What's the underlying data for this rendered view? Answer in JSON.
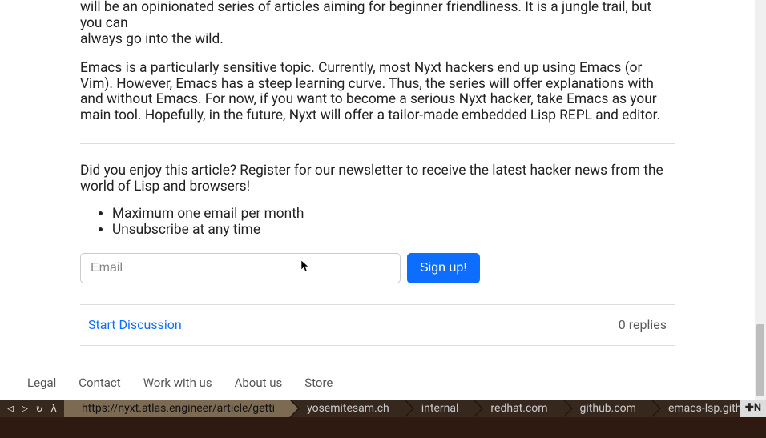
{
  "article": {
    "partial_top_line": "will be an opinionated series of articles aiming for beginner friendliness. It is a jungle trail, but you can",
    "partial_top_line2": "always go into the wild.",
    "paragraph2": "Emacs is a particularly sensitive topic. Currently, most Nyxt hackers end up using Emacs (or Vim). However, Emacs has a steep learning curve. Thus, the series will offer explanations with and without Emacs. For now, if you want to become a serious Nyxt hacker, take Emacs as your main tool. Hopefully, in the future, Nyxt will offer a tailor-made embedded Lisp REPL and editor."
  },
  "newsletter": {
    "intro": "Did you enjoy this article? Register for our newsletter to receive the latest hacker news from the world of Lisp and browsers!",
    "bullets": [
      "Maximum one email per month",
      "Unsubscribe at any time"
    ],
    "email_placeholder": "Email",
    "signup_label": "Sign up!"
  },
  "discussion": {
    "start_label": "Start Discussion",
    "reply_count": "0 replies"
  },
  "footer": {
    "links": [
      "Legal",
      "Contact",
      "Work with us",
      "About us",
      "Store"
    ]
  },
  "statusbar": {
    "nav": {
      "back": "◁",
      "forward": "▷",
      "reload": "↻",
      "lambda": "λ"
    },
    "tabs": [
      {
        "label": "https://nyxt.atlas.engineer/article/getti",
        "active": true
      },
      {
        "label": "yosemitesam.ch",
        "active": false
      },
      {
        "label": "internal",
        "active": false
      },
      {
        "label": "redhat.com",
        "active": false
      },
      {
        "label": "github.com",
        "active": false
      },
      {
        "label": "emacs-lsp.gith",
        "active": false
      }
    ],
    "new_tab": "✚N"
  }
}
